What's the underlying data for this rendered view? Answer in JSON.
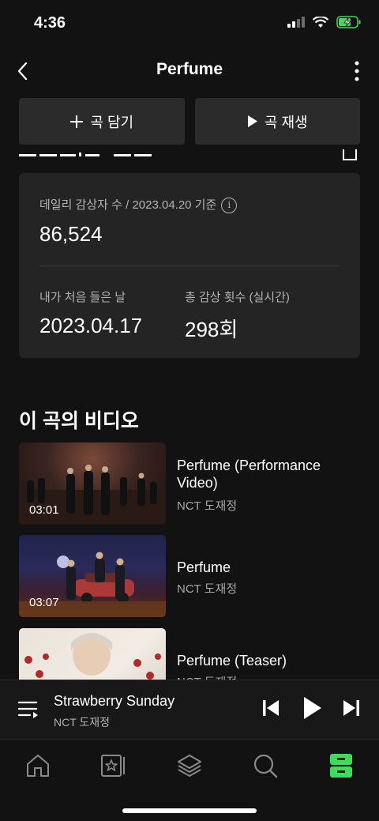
{
  "status": {
    "time": "4:36"
  },
  "header": {
    "title": "Perfume"
  },
  "actions": {
    "add_label": "곡 담기",
    "play_label": "곡 재생"
  },
  "stats": {
    "daily_label": "데일리 감상자 수 / 2023.04.20 기준",
    "daily_value": "86,524",
    "first_listen_label": "내가 처음 들은 날",
    "first_listen_value": "2023.04.17",
    "total_plays_label": "총 감상 횟수 (실시간)",
    "total_plays_value": "298회"
  },
  "videos_section": {
    "title": "이 곡의 비디오",
    "items": [
      {
        "title": "Perfume (Performance Video)",
        "artist": "NCT 도재정",
        "duration": "03:01"
      },
      {
        "title": "Perfume",
        "artist": "NCT 도재정",
        "duration": "03:07"
      },
      {
        "title": "Perfume (Teaser)",
        "artist": "NCT 도재정",
        "duration": ""
      }
    ]
  },
  "now_playing": {
    "title": "Strawberry Sunday",
    "artist": "NCT 도재정"
  },
  "tabs": [
    {
      "name": "home",
      "icon": "home-icon"
    },
    {
      "name": "storage",
      "icon": "star-card-icon"
    },
    {
      "name": "playlist",
      "icon": "layers-icon"
    },
    {
      "name": "search",
      "icon": "search-icon"
    },
    {
      "name": "library",
      "icon": "drawer-icon",
      "active": true
    }
  ],
  "colors": {
    "accent": "#3ddc5a",
    "background": "#121212",
    "card": "#242424"
  }
}
